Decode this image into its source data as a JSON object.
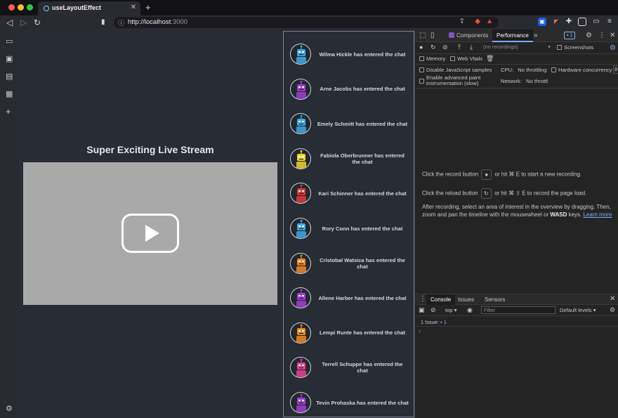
{
  "browser": {
    "tab_title": "useLayoutEffect",
    "tab_close": "✕",
    "new_tab": "+",
    "url_host": "http://localhost",
    "url_port": ":3000"
  },
  "page": {
    "stream_title": "Super Exciting Live Stream",
    "chat_messages": [
      {
        "text": "Wilma Hickle has entered the chat",
        "color": "#3fa9e6"
      },
      {
        "text": "Arne Jacobs has entered the chat",
        "color": "#a23fd3"
      },
      {
        "text": "Emely Schmitt has entered the chat",
        "color": "#3fa9e6"
      },
      {
        "text": "Fabiola Oberbrunner has entered the chat",
        "color": "#f4d22b"
      },
      {
        "text": "Kari Schinner has entered the chat",
        "color": "#e03a3a"
      },
      {
        "text": "Rory Conn has entered the chat",
        "color": "#3fa9e6"
      },
      {
        "text": "Cristobal Watsica has entered the chat",
        "color": "#f08a24"
      },
      {
        "text": "Allene Harber has entered the chat",
        "color": "#a23fd3"
      },
      {
        "text": "Lempi Runte has entered the chat",
        "color": "#f08a24"
      },
      {
        "text": "Terrell Schuppe has entered the chat",
        "color": "#e84393"
      },
      {
        "text": "Tevin Prohaska has entered the chat",
        "color": "#a23fd3"
      }
    ]
  },
  "devtools": {
    "tabs": [
      "Components",
      "Performance"
    ],
    "more_tabs": "»",
    "issue_count": "1",
    "recordings_placeholder": "(no recordings)",
    "screenshots_label": "Screenshots",
    "memory_label": "Memory",
    "web_vitals_label": "Web Vitals",
    "disable_js_samples": "Disable JavaScript samples",
    "cpu_label": "CPU:",
    "cpu_value": "No throttling",
    "hw_concurrency": "Hardware concurrency",
    "hw_value": "8",
    "adv_paint_1": "Enable advanced paint",
    "adv_paint_2": "instrumentation (slow)",
    "network_label": "Network:",
    "network_value": "No throttl",
    "msg_record_pre": "Click the record button",
    "msg_record_post": "or hit ⌘ E to start a new recording.",
    "msg_reload_pre": "Click the reload button",
    "msg_reload_post": "or hit ⌘ ⇧ E to record the page load.",
    "msg_after_1": "After recording, select an area of interest in the overview by dragging. Then,",
    "msg_after_2": "zoom and pan the timeline with the mousewheel or",
    "msg_wasd": "WASD",
    "msg_keys": "keys.",
    "learn_more": "Learn more",
    "console_tabs": [
      "Console",
      "Issues",
      "Sensors"
    ],
    "context": "top",
    "filter_placeholder": "Filter",
    "levels": "Default levels",
    "issues_text": "1 Issue:",
    "issues_count": "1",
    "prompt": "›"
  }
}
